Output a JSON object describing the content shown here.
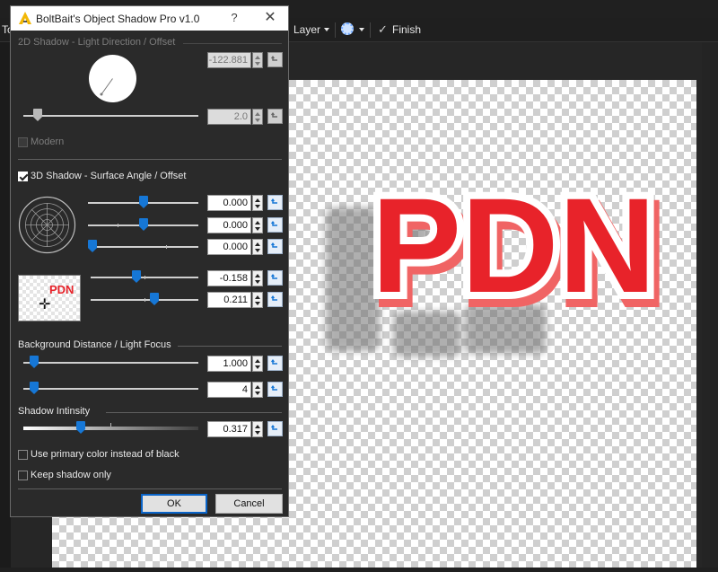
{
  "app_toolbar": {
    "left_fragment": "To",
    "layer_label": "Layer",
    "finish_label": "Finish"
  },
  "canvas": {
    "text": "PDN",
    "text_color": "#e8232a",
    "outline_color": "#ffffff",
    "extrude_color": "#f06464"
  },
  "dialog": {
    "title": "BoltBait's Object Shadow Pro v1.0",
    "help_glyph": "?",
    "close_glyph": "✕",
    "section_2d": {
      "label": "2D Shadow - Light Direction / Offset",
      "angle_value": "-122.881",
      "offset_value": "2.0",
      "offset_slider": 0.06,
      "modern_label": "Modern",
      "modern_checked": false
    },
    "section_3d": {
      "label": "3D Shadow - Surface Angle / Offset",
      "checked": true,
      "rows": [
        {
          "value": "0.000",
          "slider": 0.5
        },
        {
          "value": "0.000",
          "slider": 0.5
        },
        {
          "value": "0.000",
          "slider": 0.0
        },
        {
          "value": "-0.158",
          "slider": 0.42
        },
        {
          "value": "0.211",
          "slider": 0.6
        }
      ],
      "preview_text": "PDN"
    },
    "section_distance": {
      "label": "Background Distance / Light Focus",
      "rows": [
        {
          "value": "1.000",
          "slider": 0.04
        },
        {
          "value": "4",
          "slider": 0.04
        }
      ]
    },
    "section_intensity": {
      "label": "Shadow Intinsity",
      "value": "0.317",
      "slider": 0.32
    },
    "use_primary_label": "Use primary color instead of black",
    "keep_shadow_label": "Keep shadow only",
    "ok_label": "OK",
    "cancel_label": "Cancel"
  },
  "colors": {
    "accent": "#1677d6",
    "dialog_bg": "#2a2a2a"
  }
}
